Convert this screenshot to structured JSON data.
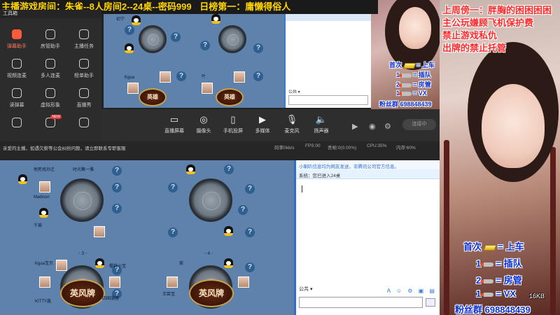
{
  "banner": {
    "room": "主播游戏房间：朱雀--8人房间2--24桌--密码999",
    "rank": "日榜第一：庸懒得俗人"
  },
  "toolpanel": {
    "header": "工具箱",
    "tools": [
      {
        "label": "弹幕助手",
        "icon": "bullet-comment-icon",
        "active": true
      },
      {
        "label": "房管助手",
        "icon": "room-manager-icon"
      },
      {
        "label": "主播任务",
        "icon": "task-icon"
      },
      {
        "label": "视频连麦",
        "icon": "video-link-icon"
      },
      {
        "label": "多人连麦",
        "icon": "multi-link-icon"
      },
      {
        "label": "榜单助手",
        "icon": "ranking-icon"
      },
      {
        "label": "读弹幕",
        "icon": "read-comment-icon"
      },
      {
        "label": "虚拟形象",
        "icon": "avatar-icon"
      },
      {
        "label": "直播秀",
        "icon": "show-icon"
      },
      {
        "label": "",
        "icon": "misc-icon"
      },
      {
        "label": "",
        "icon": "gift-icon",
        "badge": "NEW"
      },
      {
        "label": "",
        "icon": "fire-icon"
      }
    ]
  },
  "controls": [
    {
      "label": "直播屏幕",
      "icon": "screen-icon"
    },
    {
      "label": "摄像头",
      "icon": "camera-icon"
    },
    {
      "label": "手机投屏",
      "icon": "phone-cast-icon"
    },
    {
      "label": "多媒体",
      "icon": "media-icon"
    },
    {
      "label": "麦克风",
      "icon": "microphone-icon"
    },
    {
      "label": "扬声器",
      "icon": "speaker-icon"
    }
  ],
  "golive_label": "连接中",
  "stats": {
    "warning": "亲爱的主播，如遇欠薪等公会纠纷问题，请立即联系专职客服",
    "upload": "码率0kb/s",
    "fps": "FPS:00",
    "loss": "丢帧:0(0.00%)",
    "cpu": "CPU:35%",
    "mem": "内存:60%"
  },
  "game_top": {
    "players": [
      "初宁",
      "Kgua",
      "叶",
      "宝"
    ],
    "emblem": "英雄"
  },
  "chat_top": {
    "channel": "公共"
  },
  "game_bottom": {
    "table_numbers": [
      "- 3 -",
      "- 4 -"
    ],
    "players": [
      "他死找孙迁",
      "时光聚一雅",
      "Madison",
      "千瑜",
      "Kgua宝贝",
      "樱桃小宝",
      "家",
      "四国潮音",
      "王臣宝",
      "KITTY鑫"
    ],
    "emblem": "英风牌"
  },
  "chat_bottom": {
    "notice": "小喇叭信息均为网友发送，非腾讯公司官方信息。",
    "system": "系统：您已进入24桌",
    "channel": "公共"
  },
  "overlay": {
    "top_lines": [
      "上周傍一：胖胸的困困困困",
      "主公玩嫌顾飞机保护费",
      "禁止游戏私仇",
      "出牌的禁止托管"
    ],
    "small_rules": [
      {
        "left": "首次",
        "right": "上车"
      },
      {
        "left": "1",
        "right": "插队"
      },
      {
        "left": "2",
        "right": "房管"
      },
      {
        "left": "1",
        "right": "VX"
      }
    ],
    "small_fans": "粉丝群 698848439",
    "big_rules": [
      {
        "left": "首次",
        "right": "= 上车"
      },
      {
        "left": "1",
        "right": "= 插队"
      },
      {
        "left": "2",
        "right": "= 房管"
      },
      {
        "left": "1",
        "right": "= VX"
      }
    ],
    "big_fans": "粉丝群 698848439",
    "version": "16KB"
  },
  "colors": {
    "accent": "#ff5a3c",
    "banner_text": "#ffd400",
    "game_bg": "#5e82ac",
    "overlay_red": "#ff2a2a",
    "overlay_yellow": "#ffe600"
  }
}
